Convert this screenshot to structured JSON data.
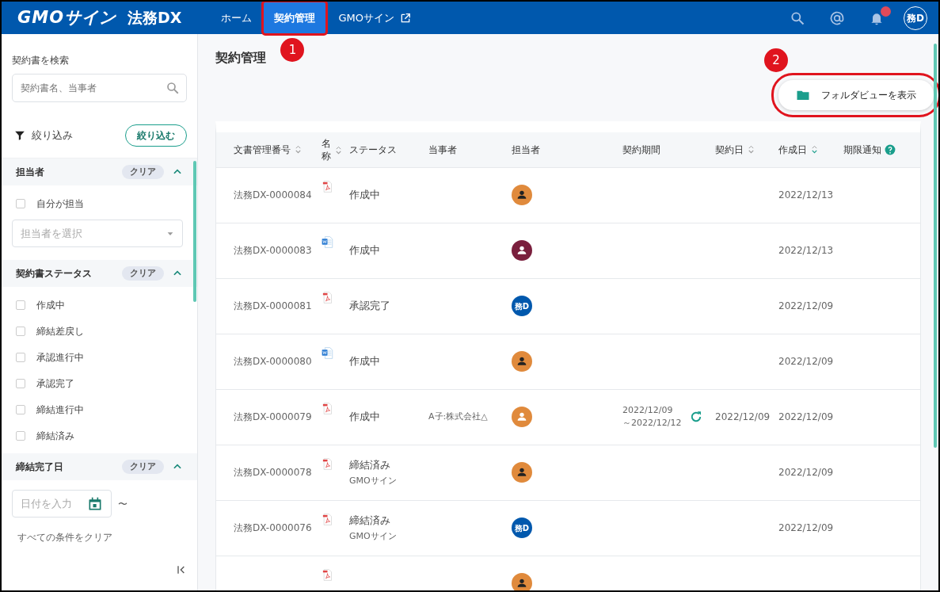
{
  "header": {
    "logo": "GMOサイン",
    "product": "法務DX",
    "nav": [
      {
        "label": "ホーム",
        "selected": false,
        "external": false,
        "highlighted": false
      },
      {
        "label": "契約管理",
        "selected": true,
        "external": false,
        "highlighted": true,
        "callout": "1"
      },
      {
        "label": "GMOサイン",
        "selected": false,
        "external": true,
        "highlighted": false
      }
    ],
    "notification_badge": true,
    "user_avatar": "務D"
  },
  "sidebar": {
    "search_label": "契約書を検索",
    "search_placeholder": "契約書名、当事者",
    "filter_label": "絞り込み",
    "filter_button": "絞り込む",
    "sections": [
      {
        "title": "担当者",
        "clear": "クリア",
        "expanded": true,
        "items": [
          {
            "kind": "checkbox",
            "label": "自分が担当",
            "checked": false
          },
          {
            "kind": "select",
            "placeholder": "担当者を選択"
          }
        ]
      },
      {
        "title": "契約書ステータス",
        "clear": "クリア",
        "expanded": true,
        "items": [
          {
            "kind": "checkbox",
            "label": "作成中",
            "checked": false
          },
          {
            "kind": "checkbox",
            "label": "締結差戻し",
            "checked": false
          },
          {
            "kind": "checkbox",
            "label": "承認進行中",
            "checked": false
          },
          {
            "kind": "checkbox",
            "label": "承認完了",
            "checked": false
          },
          {
            "kind": "checkbox",
            "label": "締結進行中",
            "checked": false
          },
          {
            "kind": "checkbox",
            "label": "締結済み",
            "checked": false
          }
        ]
      },
      {
        "title": "締結完了日",
        "clear": "クリア",
        "expanded": true,
        "items": [
          {
            "kind": "daterange",
            "placeholder": "日付を入力",
            "separator": "〜"
          }
        ]
      }
    ],
    "clear_all": "すべての条件をクリア"
  },
  "main": {
    "title": "契約管理",
    "folder_button": {
      "label": "フォルダビューを表示",
      "highlighted": true,
      "callout": "2"
    },
    "table": {
      "columns": [
        {
          "label": "文書管理番号",
          "sortable": true,
          "sort_active": false
        },
        {
          "label": "名称",
          "sortable": true,
          "sort_active": false
        },
        {
          "label": "ステータス"
        },
        {
          "label": "当事者"
        },
        {
          "label": "担当者"
        },
        {
          "label": "契約期間"
        },
        {
          "label": "契約日",
          "sortable": true,
          "sort_active": false
        },
        {
          "label": "作成日",
          "sortable": true,
          "sort_active": true
        },
        {
          "label": "期限通知",
          "help": true
        }
      ],
      "rows": [
        {
          "id": "法務DX-0000084",
          "file": {
            "kind": "pdf"
          },
          "status": "作成中",
          "avatar": {
            "kind": "person",
            "color": "#e08a3c"
          },
          "created": "2022/12/13"
        },
        {
          "id": "法務DX-0000083",
          "file": {
            "kind": "word"
          },
          "status": "作成中",
          "avatar": {
            "kind": "person",
            "color": "#7a1f3d"
          },
          "created": "2022/12/13"
        },
        {
          "id": "法務DX-0000081",
          "file": {
            "kind": "pdf"
          },
          "status": "承認完了",
          "avatar": {
            "kind": "text",
            "color": "#0058ad",
            "text": "務D"
          },
          "created": "2022/12/09"
        },
        {
          "id": "法務DX-0000080",
          "file": {
            "kind": "word"
          },
          "status": "作成中",
          "avatar": {
            "kind": "person",
            "color": "#e08a3c"
          },
          "created": "2022/12/09"
        },
        {
          "id": "法務DX-0000079",
          "file": {
            "kind": "pdf"
          },
          "status": "作成中",
          "party": "A子:株式会社△",
          "avatar": {
            "kind": "person",
            "color": "#e08a3c"
          },
          "period": [
            "2022/12/09",
            "～2022/12/12"
          ],
          "auto_renew": true,
          "contract_date": "2022/12/09",
          "created": "2022/12/09"
        },
        {
          "id": "法務DX-0000078",
          "file": {
            "kind": "pdf"
          },
          "status": "締結済み",
          "sub": "GMOサイン",
          "avatar": {
            "kind": "person",
            "color": "#e08a3c"
          },
          "created": "2022/12/09"
        },
        {
          "id": "法務DX-0000076",
          "file": {
            "kind": "pdf"
          },
          "status": "締結済み",
          "sub": "GMOサイン",
          "avatar": {
            "kind": "text",
            "color": "#0058ad",
            "text": "務D"
          },
          "created": "2022/12/09"
        },
        {
          "file": {
            "kind": "pdf"
          },
          "avatar": {
            "kind": "person",
            "color": "#e08a3c"
          }
        }
      ]
    }
  }
}
